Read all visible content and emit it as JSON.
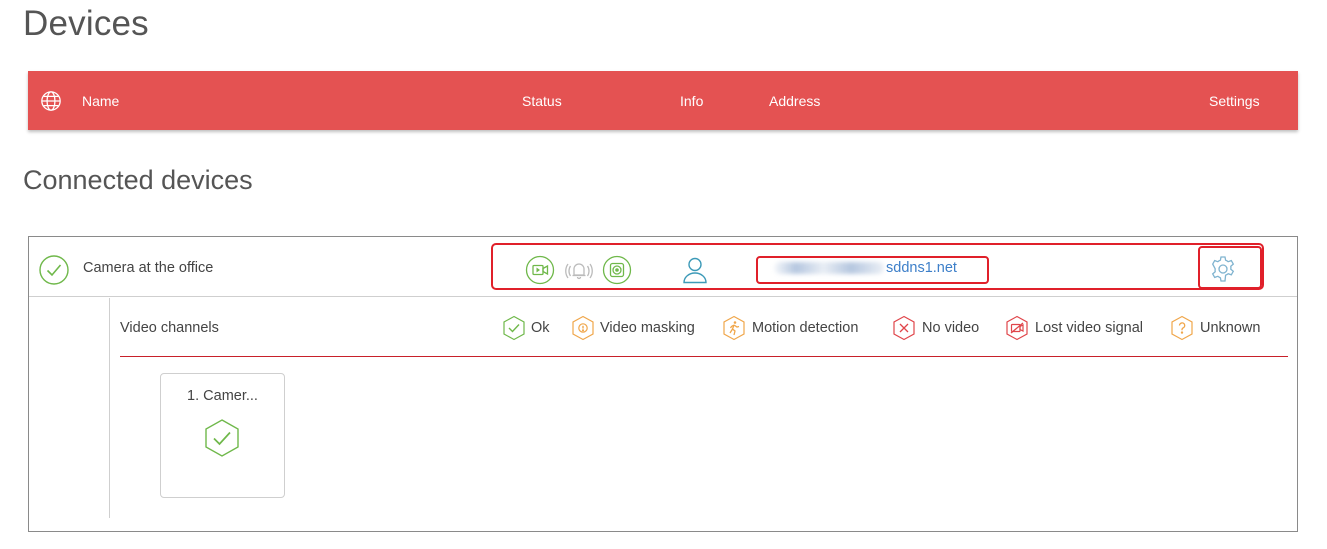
{
  "page": {
    "title": "Devices"
  },
  "header": {
    "columns": {
      "name": "Name",
      "status": "Status",
      "info": "Info",
      "address": "Address",
      "settings": "Settings"
    },
    "icon": "globe-icon",
    "color": "#e45252"
  },
  "connected": {
    "title": "Connected devices",
    "device": {
      "name": "Camera at the office",
      "status_icon": "check-circle-icon",
      "status_icons": [
        "video-camera-icon",
        "alarm-bell-icon",
        "recording-icon"
      ],
      "info_icon": "user-icon",
      "address_visible": "sddns1.net",
      "settings_icon": "gear-icon"
    },
    "channels": {
      "label": "Video channels",
      "legend": [
        {
          "label": "Ok",
          "icon": "ok-hexagon-icon",
          "color": "#6fb84a"
        },
        {
          "label": "Video masking",
          "icon": "video-masking-hexagon-icon",
          "color": "#f0a64a"
        },
        {
          "label": "Motion detection",
          "icon": "motion-detection-hexagon-icon",
          "color": "#f0a64a"
        },
        {
          "label": "No video",
          "icon": "no-video-hexagon-icon",
          "color": "#e0454a"
        },
        {
          "label": "Lost video signal",
          "icon": "lost-video-signal-hexagon-icon",
          "color": "#e0454a"
        },
        {
          "label": "Unknown",
          "icon": "unknown-hexagon-icon",
          "color": "#f0a64a"
        }
      ],
      "items": [
        {
          "name": "1. Camer...",
          "status": "ok"
        }
      ]
    }
  },
  "colors": {
    "accent": "#e45252",
    "ok": "#6fb84a",
    "link": "#3d7fc9",
    "highlight": "#e0202a"
  }
}
